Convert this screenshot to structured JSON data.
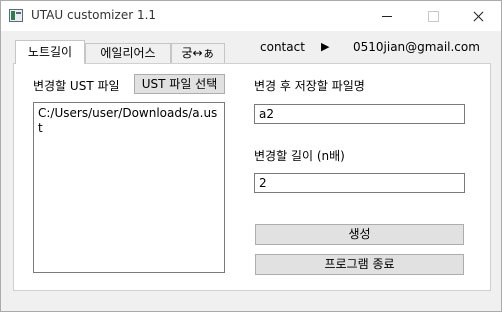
{
  "window": {
    "title": "UTAU customizer 1.1"
  },
  "tabs": [
    {
      "label": "노트길이",
      "active": true
    },
    {
      "label": "에일리어스",
      "active": false
    },
    {
      "label": "궁↔ぁ",
      "active": false
    }
  ],
  "contact": {
    "label": "contact",
    "arrow": "▶",
    "email": "0510jian@gmail.com"
  },
  "left": {
    "ust_label": "변경할 UST 파일",
    "select_button": "UST 파일 선택",
    "path": "C:/Users/user/Downloads/a.ust"
  },
  "right": {
    "save_label": "변경 후 저장할 파일명",
    "save_value": "a2",
    "length_label": "변경할 길이 (n배)",
    "length_value": "2",
    "generate_button": "생성",
    "exit_button": "프로그램 종료"
  }
}
